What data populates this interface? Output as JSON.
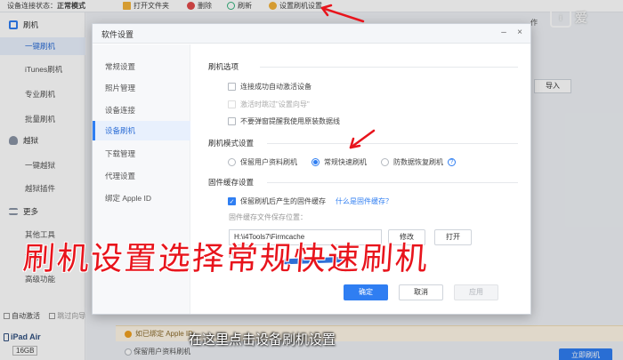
{
  "app": {
    "status_text": "设备连接状态：",
    "status_value": "正常模式",
    "toolbar": [
      {
        "label": "打开文件夹",
        "color": "#f3b23a"
      },
      {
        "label": "删除",
        "color": "#e24b4b"
      },
      {
        "label": "刷新",
        "color": "#36b37e"
      },
      {
        "label": "设置刷机设置",
        "color": "#f3b23a"
      }
    ],
    "right_label": "作",
    "import_label": "导入"
  },
  "sidebar": {
    "items": [
      {
        "label": "刷机",
        "type": "head",
        "icon_color": "#2f7ef2"
      },
      {
        "label": "一键刷机",
        "type": "sub",
        "active": true
      },
      {
        "label": "iTunes刷机",
        "type": "sub"
      },
      {
        "label": "专业刷机",
        "type": "sub"
      },
      {
        "label": "批量刷机",
        "type": "sub"
      },
      {
        "label": "越狱",
        "type": "head",
        "icon_color": "#8a94a6"
      },
      {
        "label": "一键越狱",
        "type": "sub"
      },
      {
        "label": "越狱插件",
        "type": "sub"
      },
      {
        "label": "更多",
        "type": "head",
        "icon_color": "#8a94a6"
      },
      {
        "label": "其他工具",
        "type": "sub"
      },
      {
        "label": "下载",
        "type": "sub"
      },
      {
        "label": "高级功能",
        "type": "sub"
      }
    ],
    "auto_activate": "自动激活",
    "skip_guide": "跳过向导",
    "device_name": "iPad Air",
    "device_storage": "16GB"
  },
  "banner": {
    "text": "如已绑定 Apple ID"
  },
  "background_primary_button": "立即刷机",
  "background_radio_text": "保留用户资料刷机",
  "dialog": {
    "title": "软件设置",
    "nav": [
      {
        "label": "常规设置"
      },
      {
        "label": "照片管理"
      },
      {
        "label": "设备连接"
      },
      {
        "label": "设备刷机",
        "active": true
      },
      {
        "label": "下载管理"
      },
      {
        "label": "代理设置"
      },
      {
        "label": "绑定 Apple ID"
      }
    ],
    "section_flash_options": "刷机选项",
    "opt_auto_activate": "连接成功自动激活设备",
    "opt_skip_guide": "激活时跳过\"设置向导\"",
    "opt_no_remind": "不要弹窗提醒我使用原装数据线",
    "section_flash_mode": "刷机模式设置",
    "mode_keep_data": "保留用户资料刷机",
    "mode_fast": "常规快速刷机",
    "mode_anti_recover": "防数据恢复刷机",
    "section_firmware_cache": "固件缓存设置",
    "opt_keep_firmware": "保留刷机后产生的固件缓存",
    "what_is_cache": "什么是固件缓存？",
    "cache_path_label": "固件缓存文件保存位置：",
    "cache_path_value": "H:\\i4Tools7\\Firmcache",
    "btn_modify": "修改",
    "btn_open": "打开",
    "cache_info_partial": "Ha",
    "btn_ok": "确定",
    "btn_cancel": "取消",
    "btn_apply": "应用"
  },
  "overlay": {
    "big_caption": "刷机设置选择常规快速刷机",
    "sub_caption": "在这里点击设备刷机设置",
    "watermark": "爱"
  }
}
